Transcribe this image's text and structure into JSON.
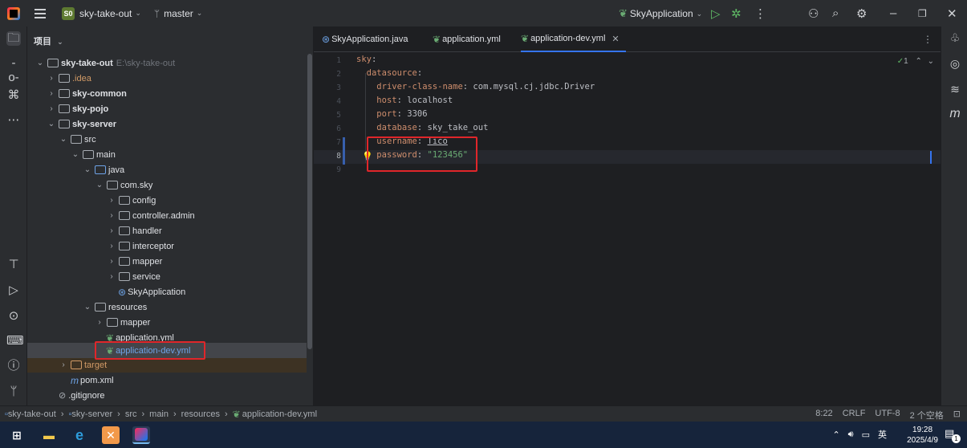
{
  "titlebar": {
    "project_badge": "S0",
    "project_name": "sky-take-out",
    "branch": "master",
    "run_config": "SkyApplication"
  },
  "project_panel": {
    "header": "项目",
    "tree": [
      {
        "label": "sky-take-out",
        "path": "E:\\sky-take-out",
        "indent": 0
      },
      {
        "label": ".idea",
        "indent": 1
      },
      {
        "label": "sky-common",
        "indent": 1
      },
      {
        "label": "sky-pojo",
        "indent": 1
      },
      {
        "label": "sky-server",
        "indent": 1
      },
      {
        "label": "src",
        "indent": 2
      },
      {
        "label": "main",
        "indent": 3
      },
      {
        "label": "java",
        "indent": 4
      },
      {
        "label": "com.sky",
        "indent": 5
      },
      {
        "label": "config",
        "indent": 6
      },
      {
        "label": "controller.admin",
        "indent": 6
      },
      {
        "label": "handler",
        "indent": 6
      },
      {
        "label": "interceptor",
        "indent": 6
      },
      {
        "label": "mapper",
        "indent": 6
      },
      {
        "label": "service",
        "indent": 6
      },
      {
        "label": "SkyApplication",
        "indent": 6
      },
      {
        "label": "resources",
        "indent": 4
      },
      {
        "label": "mapper",
        "indent": 5
      },
      {
        "label": "application.yml",
        "indent": 5
      },
      {
        "label": "application-dev.yml",
        "indent": 5
      },
      {
        "label": "target",
        "indent": 2
      },
      {
        "label": "pom.xml",
        "indent": 2
      },
      {
        "label": ".gitignore",
        "indent": 1
      }
    ]
  },
  "editor": {
    "tabs": [
      {
        "label": "SkyApplication.java"
      },
      {
        "label": "application.yml"
      },
      {
        "label": "application-dev.yml"
      }
    ],
    "problems_count": "1",
    "lines": [
      {
        "no": "1",
        "key": "sky",
        "value": ""
      },
      {
        "no": "2",
        "key": "datasource",
        "value": ""
      },
      {
        "no": "3",
        "key": "driver-class-name",
        "value": "com.mysql.cj.jdbc.Driver"
      },
      {
        "no": "4",
        "key": "host",
        "value": "localhost"
      },
      {
        "no": "5",
        "key": "port",
        "value": "3306"
      },
      {
        "no": "6",
        "key": "database",
        "value": "sky_take_out"
      },
      {
        "no": "7",
        "key": "username",
        "value": "Tico"
      },
      {
        "no": "8",
        "key": "password",
        "value": "\"123456\""
      },
      {
        "no": "9",
        "key": "",
        "value": ""
      }
    ]
  },
  "statusbar": {
    "breadcrumb": [
      "sky-take-out",
      "sky-server",
      "src",
      "main",
      "resources",
      "application-dev.yml"
    ],
    "position": "8:22",
    "line_sep": "CRLF",
    "encoding": "UTF-8",
    "indent": "2 个空格"
  },
  "taskbar": {
    "ime": "英",
    "time": "19:28",
    "date": "2025/4/9",
    "notif_count": "1"
  }
}
